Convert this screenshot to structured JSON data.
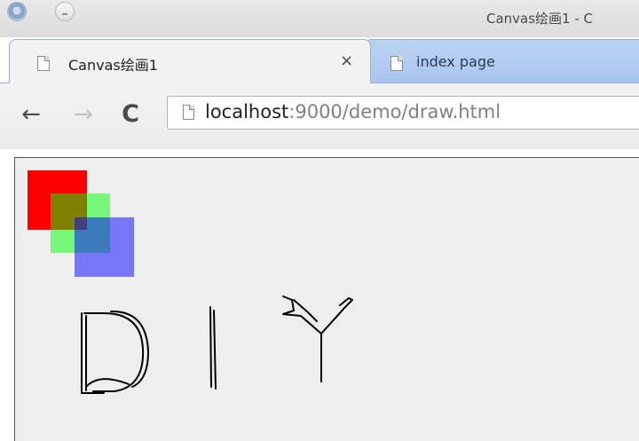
{
  "window": {
    "title": "Canvas绘画1 - C"
  },
  "tabs": [
    {
      "label": "Canvas绘画1",
      "active": true,
      "close_glyph": "×"
    },
    {
      "label": "index page",
      "active": false
    }
  ],
  "toolbar": {
    "back_glyph": "←",
    "forward_glyph": "→",
    "reload_glyph": "C"
  },
  "address_bar": {
    "host": "localhost",
    "rest": ":9000/demo/draw.html"
  },
  "canvas": {
    "squares": [
      {
        "name": "red-square",
        "color": "#ff0000",
        "opacity": 1.0
      },
      {
        "name": "green-square",
        "color": "#00ff00",
        "opacity": 0.5
      },
      {
        "name": "blue-square",
        "color": "#0000ff",
        "opacity": 0.5
      }
    ],
    "stroke_color": "#000000",
    "drawn_marks": [
      "D",
      "|",
      "Y"
    ]
  },
  "colors": {
    "active_tab": "#f3f3f3",
    "inactive_tab": "#a9c4ee",
    "canvas_background": "#eeeeee"
  }
}
